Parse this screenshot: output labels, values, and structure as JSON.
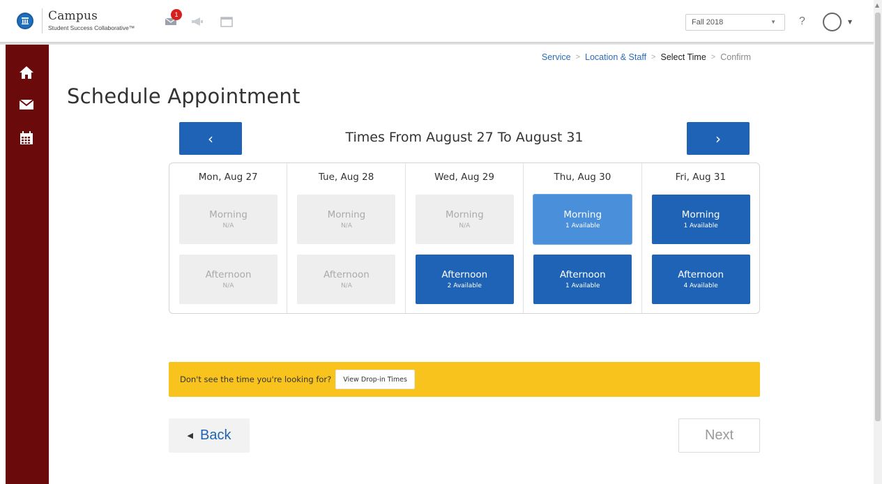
{
  "brand": {
    "name": "Campus",
    "subtitle": "Student Success Collaborative™"
  },
  "header": {
    "notification_count": "1",
    "term_selected": "Fall 2018",
    "help_label": "?",
    "icons": [
      "university-logo-icon",
      "messages-icon",
      "megaphone-icon",
      "window-icon",
      "chevron-down-icon",
      "avatar-icon"
    ]
  },
  "sidebar": {
    "items": [
      {
        "icon": "home-icon"
      },
      {
        "icon": "envelope-icon"
      },
      {
        "icon": "calendar-icon"
      }
    ]
  },
  "breadcrumb": {
    "steps": [
      "Service",
      "Location & Staff",
      "Select Time",
      "Confirm"
    ],
    "separator": ">",
    "current_index": 2
  },
  "page": {
    "title": "Schedule Appointment"
  },
  "week": {
    "prev_label": "‹",
    "next_label": "›",
    "range_title": "Times From August 27 To August 31"
  },
  "days": [
    {
      "label": "Mon, Aug 27",
      "morning": {
        "name": "Morning",
        "status": "N/A",
        "state": "na"
      },
      "afternoon": {
        "name": "Afternoon",
        "status": "N/A",
        "state": "na"
      }
    },
    {
      "label": "Tue, Aug 28",
      "morning": {
        "name": "Morning",
        "status": "N/A",
        "state": "na"
      },
      "afternoon": {
        "name": "Afternoon",
        "status": "N/A",
        "state": "na"
      }
    },
    {
      "label": "Wed, Aug 29",
      "morning": {
        "name": "Morning",
        "status": "N/A",
        "state": "na"
      },
      "afternoon": {
        "name": "Afternoon",
        "status": "2 Available",
        "state": "open"
      }
    },
    {
      "label": "Thu, Aug 30",
      "morning": {
        "name": "Morning",
        "status": "1 Available",
        "state": "selected"
      },
      "afternoon": {
        "name": "Afternoon",
        "status": "1 Available",
        "state": "open"
      }
    },
    {
      "label": "Fri, Aug 31",
      "morning": {
        "name": "Morning",
        "status": "1 Available",
        "state": "open"
      },
      "afternoon": {
        "name": "Afternoon",
        "status": "4 Available",
        "state": "open"
      }
    }
  ],
  "dropin": {
    "prompt": "Don't see the time you're looking for?",
    "button_label": "View Drop-in Times"
  },
  "footer": {
    "back_label": "Back",
    "back_arrow": "◀",
    "next_label": "Next"
  },
  "colors": {
    "accent": "#1e63b5",
    "selected": "#4a8fd9",
    "sidebar": "#6b0a0a",
    "dropin_bar": "#f8c31d",
    "unavailable": "#eeeeee"
  }
}
